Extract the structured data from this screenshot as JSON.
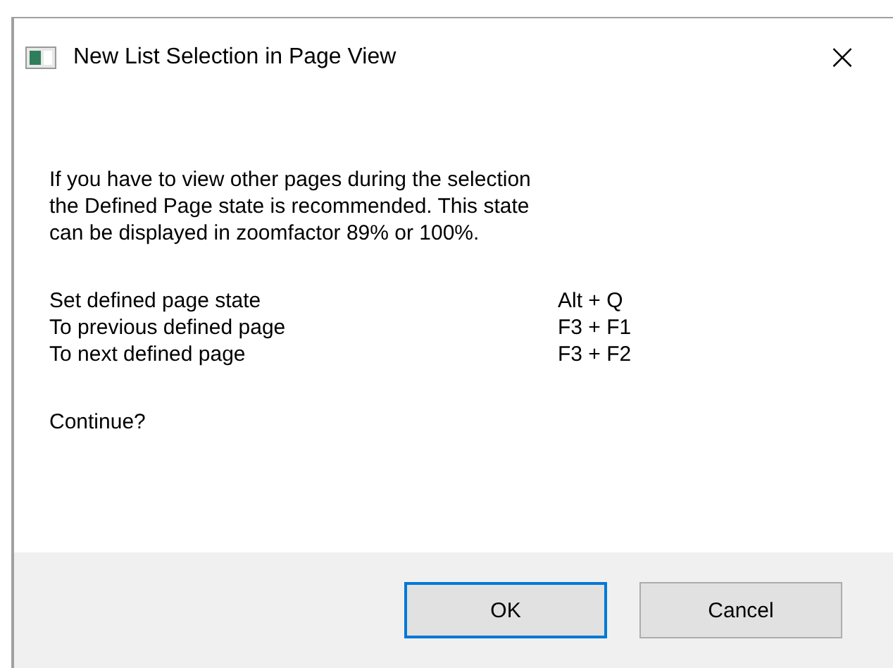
{
  "window": {
    "title": "New List Selection in Page View",
    "close": "×"
  },
  "message": [
    "If you have to view other pages during the selection",
    "the Defined Page state is recommended. This state",
    "can be displayed in zoomfactor 89% or 100%."
  ],
  "shortcuts": [
    {
      "action": "Set defined page state",
      "keys": "Alt + Q"
    },
    {
      "action": "To previous defined page",
      "keys": "F3 + F1"
    },
    {
      "action": "To next defined page",
      "keys": "F3 + F2"
    }
  ],
  "question": "Continue?",
  "buttons": [
    {
      "label": "OK",
      "default": true
    },
    {
      "label": "Cancel",
      "default": false
    }
  ]
}
